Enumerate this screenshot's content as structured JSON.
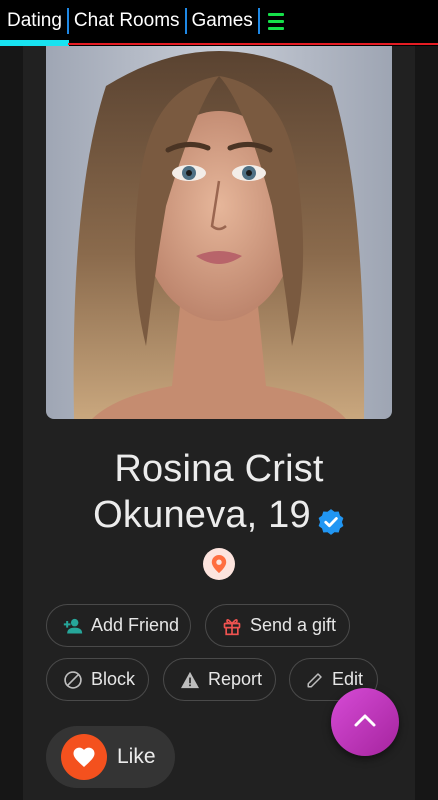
{
  "nav": {
    "tabs": [
      {
        "label": "Dating",
        "active": true
      },
      {
        "label": "Chat Rooms",
        "active": false
      },
      {
        "label": "Games",
        "active": false
      }
    ],
    "menu_icon": "hamburger-icon"
  },
  "profile": {
    "name_line1": "Rosina Crist",
    "name_line2": "Okuneva, 19",
    "verified_icon": "verified-badge-icon",
    "location_icon": "map-pin-icon"
  },
  "actions": {
    "add_friend": "Add Friend",
    "send_gift": "Send a gift",
    "block": "Block",
    "report": "Report",
    "edit": "Edit",
    "like": "Like"
  },
  "colors": {
    "accent_cyan": "#18e2f0",
    "nav_separator": "#1e88e5",
    "menu_green": "#16e04a",
    "red_line": "#e51c23",
    "verified_blue": "#2196f3",
    "like_orange": "#f4511e",
    "fab_magenta": "#c13bc1",
    "add_friend_teal": "#26a69a",
    "gift_red": "#ef5350"
  },
  "fab_icon": "chevron-up-icon"
}
